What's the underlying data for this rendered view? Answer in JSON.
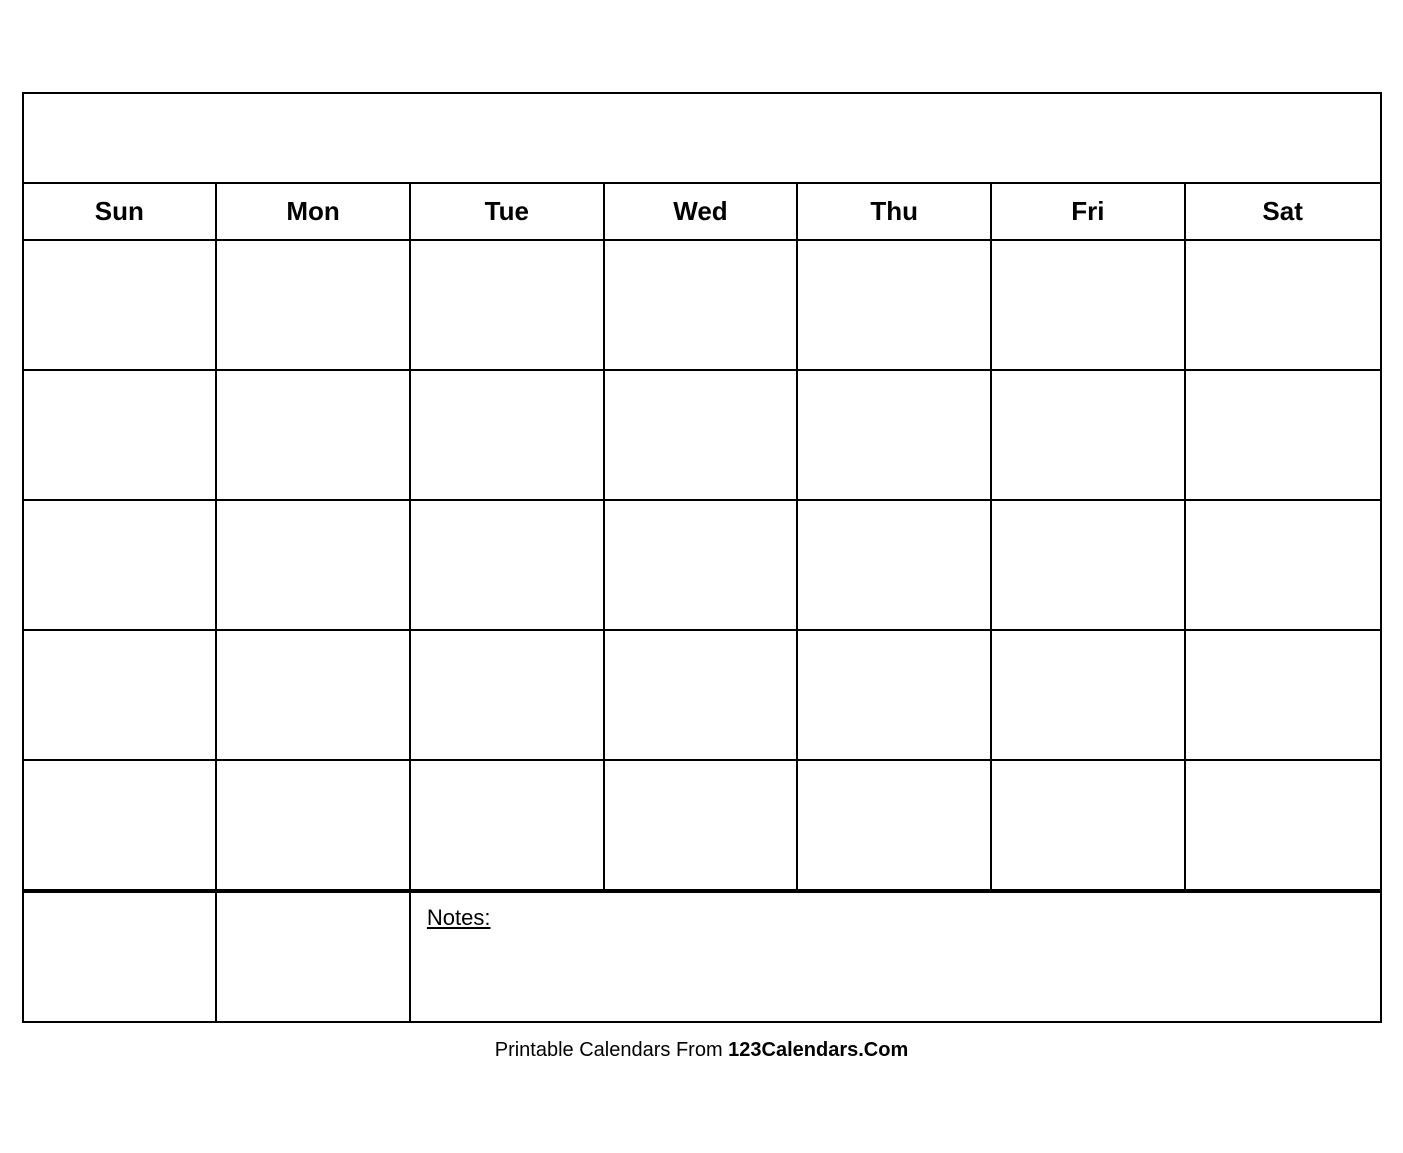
{
  "calendar": {
    "title": "",
    "days": [
      "Sun",
      "Mon",
      "Tue",
      "Wed",
      "Thu",
      "Fri",
      "Sat"
    ],
    "rows": 5,
    "notes_label": "Notes:",
    "footer_text": "Printable Calendars From ",
    "footer_brand": "123Calendars.Com"
  }
}
